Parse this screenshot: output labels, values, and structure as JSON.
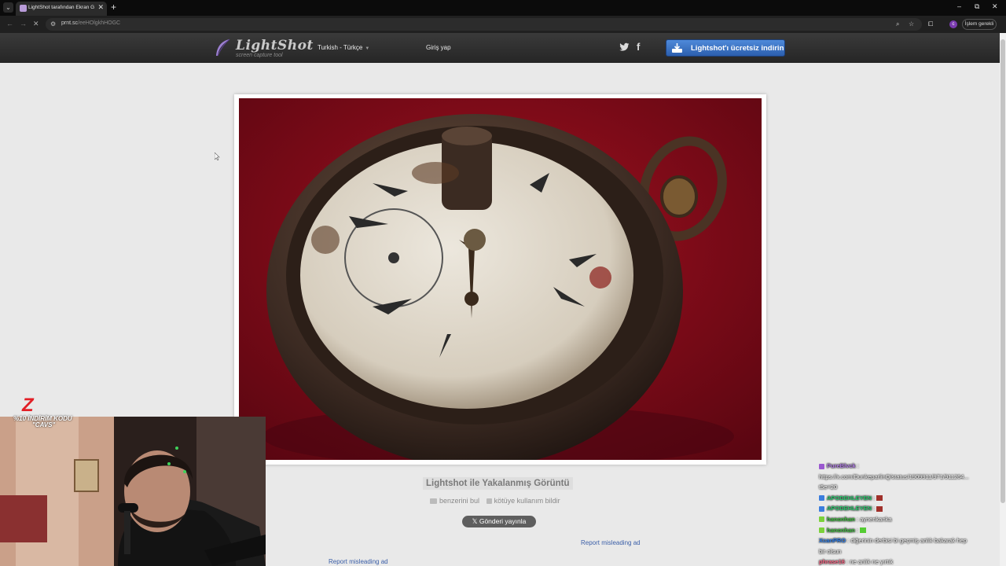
{
  "browser": {
    "tab_title": "LightShot tarafından Ekran Görü",
    "tab_close": "✕",
    "new_tab": "+",
    "url_host": "prnt.sc",
    "url_path": "/eeHOlgkhHOGC",
    "profile_initial": "c",
    "action_label": "İşlem gerekli",
    "win_minimize": "–",
    "win_restore": "⧉",
    "win_close": "✕"
  },
  "site": {
    "logo": "LightShot",
    "logo_sub": "screen capture tool",
    "language": "Turkish - Türkçe",
    "login": "Giriş yap",
    "download_button": "Lightshot'ı ücretsiz indirin",
    "accent": "#2c5fae"
  },
  "image": {
    "caption": "Lightshot ile Yakalanmış Görüntü",
    "find_similar": "benzerini bul",
    "report_abuse": "kötüye kullanım bildir",
    "share_button": "Gönderi yayınla",
    "ad_link_1": "Report misleading ad",
    "ad_link_2": "Report misleading ad"
  },
  "overlay": {
    "promo_logo": "Z",
    "promo_line1": "%10 İNDİRİM KODU",
    "promo_line2": "\"CAVS\""
  },
  "chat": [
    {
      "user": "PureBlvck",
      "text": ":",
      "color": "#b27ee6",
      "badge": "#9b59d0"
    },
    {
      "user": "",
      "text": "https://x.com/DunkeparlinQ/status/1909911/971/911264...",
      "color": "#ffffff",
      "badge": ""
    },
    {
      "user": "",
      "text": "t5e=20",
      "color": "#ffffff",
      "badge": ""
    },
    {
      "user": "APODEHLEYEN",
      "text": ":",
      "color": "#2ecc71",
      "badge": "#3b7ddd",
      "emote": "#a0302a"
    },
    {
      "user": "APODEHLEYEN",
      "text": ":",
      "color": "#2ecc71",
      "badge": "#3b7ddd",
      "emote": "#a0302a"
    },
    {
      "user": "hanonhan",
      "text": ": aynenkanka",
      "color": "#3fbf3f",
      "badge": "#7bd13a"
    },
    {
      "user": "hanonhan",
      "text": ":",
      "color": "#3fbf3f",
      "badge": "#7bd13a",
      "emote": "#55cc33"
    },
    {
      "user": "XcanPRO",
      "text": ": diğerinin derbisi bi geçmiş anlık bakarak hep",
      "color": "#2f80ed",
      "badge": ""
    },
    {
      "user": "",
      "text": "bir olsun",
      "color": "#ffffff",
      "badge": ""
    },
    {
      "user": "phrase16",
      "text": ": ne anlık ne yırtık",
      "color": "#ff6b8a",
      "badge": ""
    }
  ]
}
